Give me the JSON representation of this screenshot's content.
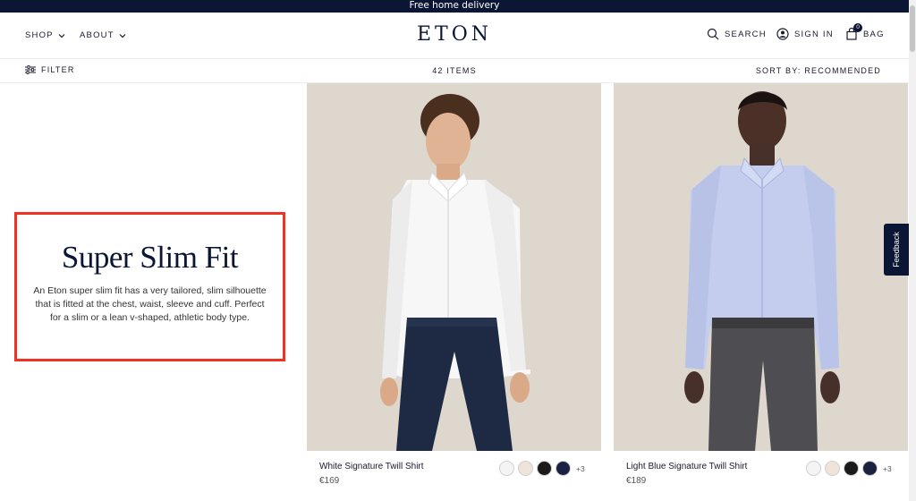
{
  "promo_bar": {
    "text": "Free home delivery"
  },
  "header": {
    "nav": [
      {
        "label": "SHOP"
      },
      {
        "label": "ABOUT"
      }
    ],
    "logo": "ETON",
    "search_label": "SEARCH",
    "signin_label": "SIGN IN",
    "bag_label": "BAG",
    "bag_count": "0"
  },
  "toolbar": {
    "filter_label": "FILTER",
    "items_count": "42 ITEMS",
    "sort_label": "SORT BY: RECOMMENDED"
  },
  "promo": {
    "title": "Super Slim Fit",
    "text": "An Eton super slim fit has a very tailored, slim silhouette that is fitted at the chest, waist, sleeve and cuff. Perfect for a slim or a lean v-shaped, athletic body type.",
    "highlight_color": "#ef3323"
  },
  "products": [
    {
      "name": "White Signature Twill Shirt",
      "price": "€169",
      "swatches": [
        "#f4f4f4",
        "#efe4da",
        "#1a1a1a",
        "#1b2140"
      ],
      "more_colors": "+3"
    },
    {
      "name": "Light Blue Signature Twill Shirt",
      "price": "€189",
      "swatches": [
        "#f4f4f4",
        "#efe4da",
        "#1a1a1a",
        "#1b2140"
      ],
      "more_colors": "+3"
    }
  ],
  "feedback_label": "Feedback",
  "colors": {
    "brand_navy": "#0b1634",
    "image_bg": "#ddd7cd"
  }
}
